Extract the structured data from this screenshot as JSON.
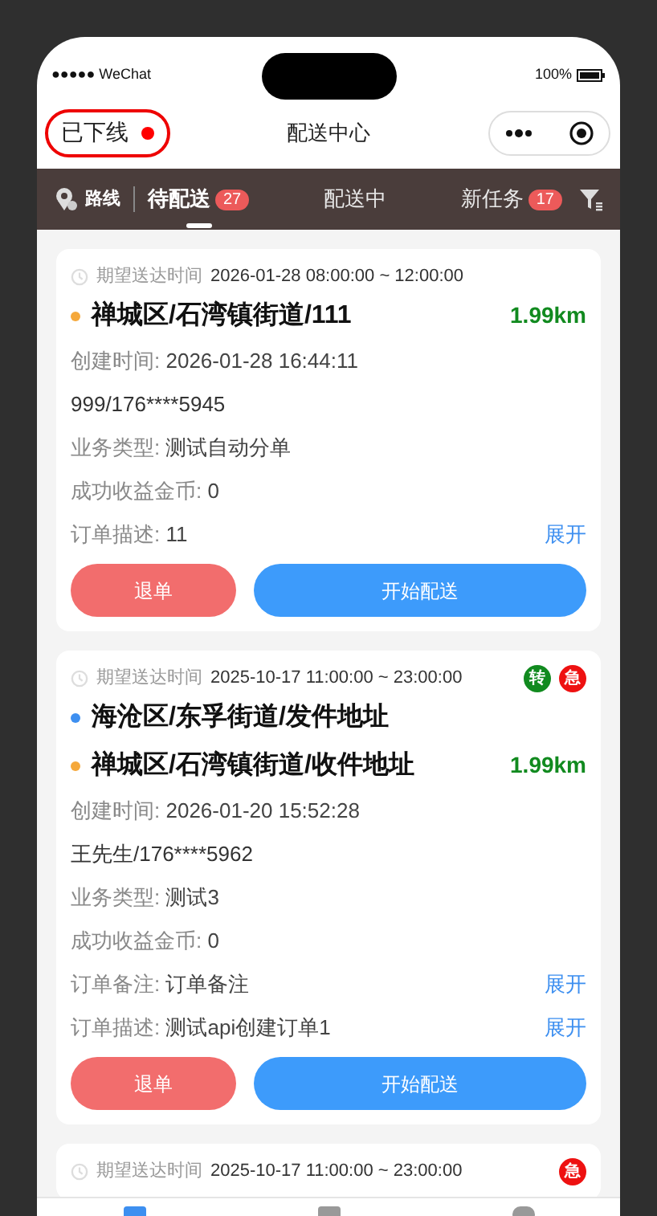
{
  "status_bar": {
    "carrier": "●●●●● WeChat",
    "battery": "100%"
  },
  "nav": {
    "status": "已下线",
    "online": false,
    "title": "配送中心"
  },
  "toolbar": {
    "route": "路线"
  },
  "tabs": [
    {
      "label": "待配送",
      "badge": "27",
      "selected": true
    },
    {
      "label": "配送中",
      "selected": false
    },
    {
      "label": "新任务",
      "badge": "17",
      "selected": false
    }
  ],
  "cards": [
    {
      "time_label": "期望送达时间",
      "time": "2026-01-28 08:00:00 ~ 12:00:00",
      "addresses": [
        {
          "text": "禅城区/石湾镇街道/111",
          "color": "#f5a83a",
          "distance": "1.99km"
        }
      ],
      "fields": [
        {
          "kind": "labeled",
          "label": "创建时间: ",
          "value": "2026-01-28 16:44:11"
        },
        {
          "kind": "contact",
          "value": "999/176****5945"
        },
        {
          "kind": "labeled",
          "label": "业务类型: ",
          "value": "测试自动分单"
        },
        {
          "kind": "labeled",
          "label": "成功收益金币: ",
          "value": "0"
        },
        {
          "kind": "labeled",
          "label": "订单描述: ",
          "value": "11",
          "action": "展开"
        }
      ],
      "buttons": [
        "退单",
        "开始配送"
      ]
    },
    {
      "time_label": "期望送达时间",
      "time": "2025-10-17 11:00:00 ~ 23:00:00",
      "tags": [
        {
          "text": "转",
          "color": "#118a1f"
        },
        {
          "text": "急",
          "color": "#ee1111"
        }
      ],
      "addresses": [
        {
          "text": "海沧区/东孚街道/发件地址",
          "color": "#3d8ff0"
        },
        {
          "text": "禅城区/石湾镇街道/收件地址",
          "color": "#f5a83a",
          "distance": "1.99km"
        }
      ],
      "fields": [
        {
          "kind": "labeled",
          "label": "创建时间: ",
          "value": "2026-01-20 15:52:28"
        },
        {
          "kind": "contact",
          "value": "王先生/176****5962"
        },
        {
          "kind": "labeled",
          "label": "业务类型: ",
          "value": "测试3"
        },
        {
          "kind": "labeled",
          "label": "成功收益金币: ",
          "value": "0"
        },
        {
          "kind": "labeled",
          "label": "订单备注: ",
          "value": "订单备注",
          "action": "展开"
        },
        {
          "kind": "labeled",
          "label": "订单描述: ",
          "value": "测试api创建订单1",
          "action": "展开"
        }
      ],
      "buttons": [
        "退单",
        "开始配送"
      ]
    },
    {
      "time_label": "期望送达时间",
      "time": "2025-10-17 11:00:00 ~ 23:00:00",
      "tags": [
        {
          "text": "急",
          "color": "#ee1111"
        }
      ]
    }
  ],
  "bottom_tabs": [
    {
      "selected": true
    },
    {
      "selected": false
    },
    {
      "selected": false
    }
  ]
}
